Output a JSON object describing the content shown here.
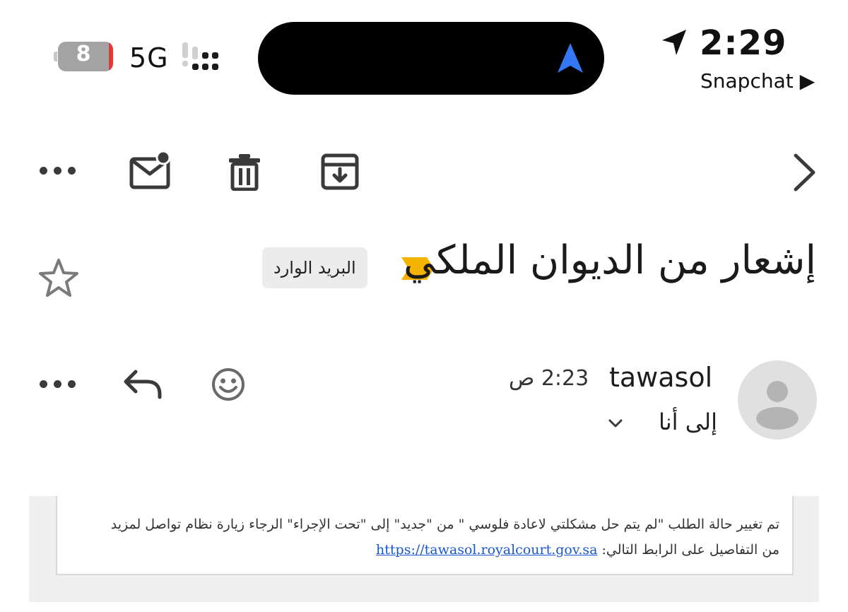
{
  "status_bar": {
    "battery_level": "8",
    "network": "5G",
    "time": "2:29",
    "back_app": "Snapchat ▶"
  },
  "toolbar": {
    "icons": [
      "more-icon",
      "mark-unread-icon",
      "trash-icon",
      "archive-icon",
      "chevron-right-icon"
    ]
  },
  "email": {
    "subject": "إشعار من الديوان الملكي",
    "label": "البريد الوارد",
    "important_color": "#F4B400",
    "sender": "tawasol",
    "time": "2:23 ص",
    "recipient": "إلى أنا",
    "body_line1": "تم تغيير حالة الطلب \"لم يتم حل مشكلتي لاعادة فلوسي \" من \"جديد\" إلى \"تحت الإجراء\" الرجاء زيارة نظام تواصل لمزيد",
    "body_line2": "من التفاصيل على الرابط التالي:",
    "link": "https://tawasol.royalcourt.gov.sa"
  },
  "colors": {
    "accent_blue": "#3478F6",
    "link": "#1A57C8",
    "battery_red": "#E53935"
  }
}
